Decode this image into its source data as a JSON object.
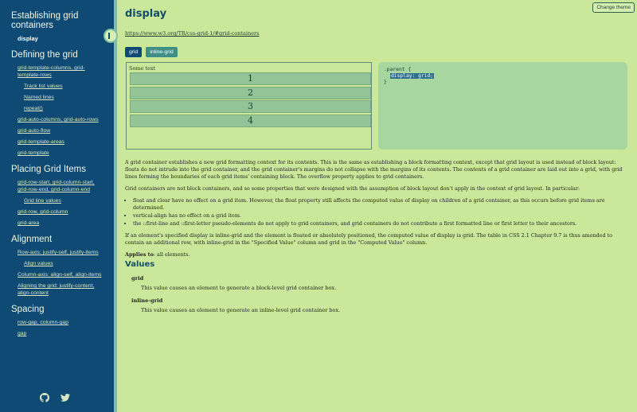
{
  "sidebar": {
    "section_establishing": "Establishing grid containers",
    "current": "display",
    "section_defining": "Defining the grid",
    "defining_links": [
      "grid-template-columns, grid-template-rows",
      "Track list values",
      "Named lines",
      "repeat()",
      "grid-auto-columns, grid-auto-rows",
      "grid-auto-flow",
      "grid-template-areas",
      "grid-template"
    ],
    "section_placing": "Placing Grid Items",
    "placing_links": [
      "grid-row-start, grid-column-start, grid-row-end, grid-column-end",
      "Grid line values",
      "grid-row, grid-column",
      "grid-area"
    ],
    "section_alignment": "Alignment",
    "alignment_links": [
      "Row-axis: justify-self, justify-items",
      "Align values",
      "Column-axis: align-self, align-items",
      "Aligning the grid: justify-content, align-content"
    ],
    "section_spacing": "Spacing",
    "spacing_links": [
      "row-gap, column-gap",
      "gap"
    ]
  },
  "header": {
    "change_theme": "Change theme",
    "title": "display",
    "url": "https://www.w3.org/TR/css-grid-1/#grid-containers"
  },
  "tabs": [
    "grid",
    "inline-grid"
  ],
  "demo": {
    "label": "Some text",
    "rows": [
      "1",
      "2",
      "3",
      "4"
    ]
  },
  "code": {
    "line1": ".parent {",
    "line2": "display: grid;",
    "line3": "}"
  },
  "prose": {
    "p1": "A grid container establishes a new grid formatting context for its contents. This is the same as establishing a block formatting context, except that grid layout is used instead of block layout: floats do not intrude into the grid container, and the grid container's margins do not collapse with the margins of its contents. The contents of a grid container are laid out into a grid, with grid lines forming the boundaries of each grid items' containing block. The overflow property applies to grid containers.",
    "p2": "Grid containers are not block containers, and so some properties that were designed with the assumption of block layout don't apply in the context of grid layout. In particular:",
    "li1": "float and clear have no effect on a grid item. However, the float property still affects the computed value of display on children of a grid container, as this occurs before grid items are determined.",
    "li2": "vertical-align has no effect on a grid item.",
    "li3": "the ::first-line and ::first-letter pseudo-elements do not apply to grid containers, and grid containers do not contribute a first formatted line or first letter to their ancestors.",
    "p3": "If an element's specified display is inline-grid and the element is floated or absolutely positioned, the computed value of display is grid. The table in CSS 2.1 Chapter 9.7 is thus amended to contain an additional row, with inline-grid in the \"Specified Value\" column and grid in the \"Computed Value\" column.",
    "applies_label": "Applies to",
    "applies_value": ": all elements."
  },
  "values": {
    "heading": "Values",
    "grid_term": "grid",
    "grid_desc": "This value causes an element to generate a block-level grid container box.",
    "inline_term": "inline-grid",
    "inline_desc": "This value causes an element to generate an inline-level grid container box."
  },
  "icons": [
    "github-icon",
    "twitter-icon"
  ]
}
